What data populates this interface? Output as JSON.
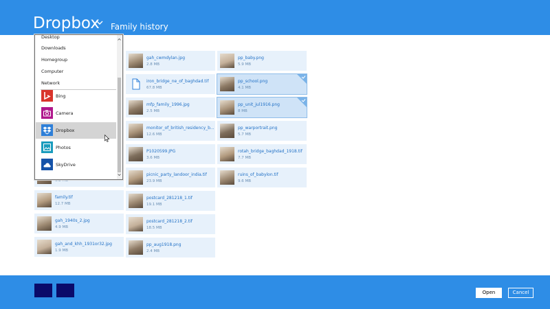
{
  "header": {
    "app_title": "Dropbox",
    "folder_title": "Family history"
  },
  "dropdown": {
    "locations": [
      "Desktop",
      "Downloads",
      "Homegroup",
      "Computer",
      "Network"
    ],
    "apps": [
      {
        "label": "Bing",
        "icon": "bing-icon",
        "color": "#d9342b"
      },
      {
        "label": "Camera",
        "icon": "camera-icon",
        "color": "#b0178c"
      },
      {
        "label": "Dropbox",
        "icon": "dropbox-icon",
        "color": "#2e7fd8"
      },
      {
        "label": "Photos",
        "icon": "photos-icon",
        "color": "#1a9cbd"
      },
      {
        "label": "SkyDrive",
        "icon": "skydrive-icon",
        "color": "#1553a9"
      }
    ]
  },
  "files": {
    "col1": [
      {
        "name": "family.tif",
        "size": "12.7 MB"
      },
      {
        "name": "gah_1940s_2.jpg",
        "size": "4.9 MB"
      },
      {
        "name": "gah_and_khh_1931or32.jpg",
        "size": "1.9 MB"
      }
    ],
    "col2": [
      {
        "name": "gah_cwmdylan.jpg",
        "size": "2.8 MB"
      },
      {
        "name": "iron_bridge_ne_of_baghdad.tif",
        "size": "67.8 MB"
      },
      {
        "name": "mfp_family_1996.jpg",
        "size": "2.5 MB"
      },
      {
        "name": "monitor_of_british_residency_b...",
        "size": "12.6 MB"
      },
      {
        "name": "P1020599.JPG",
        "size": "3.6 MB"
      },
      {
        "name": "picnic_party_landoor_india.tif",
        "size": "23.9 MB"
      },
      {
        "name": "postcard_281218_1.tif",
        "size": "19.1 MB"
      },
      {
        "name": "postcard_281218_2.tif",
        "size": "18.5 MB"
      },
      {
        "name": "pp_aug1918.png",
        "size": "2.4 MB"
      }
    ],
    "col3": [
      {
        "name": "pp_baby.png",
        "size": "5.9 MB"
      },
      {
        "name": "pp_school.png",
        "size": "4.1 MB",
        "selected": true
      },
      {
        "name": "pp_unit_jul1916.png",
        "size": "8 MB",
        "selected": true
      },
      {
        "name": "pp_warportrait.png",
        "size": "5.7 MB"
      },
      {
        "name": "rotah_bridge_baghdad_1918.tif",
        "size": "7.7 MB"
      },
      {
        "name": "ruins_of_babylon.tif",
        "size": "9.6 MB"
      }
    ],
    "partial_size": "6.2 MB"
  },
  "footer": {
    "open_label": "Open",
    "cancel_label": "Cancel"
  },
  "colors": {
    "accent": "#2e8de6",
    "tile": "#e7f1fb",
    "selection_box": "#0a0a6a"
  }
}
